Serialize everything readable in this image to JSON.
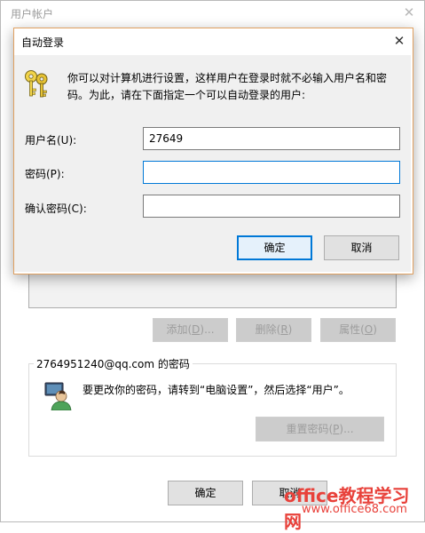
{
  "background_window": {
    "title": "用户帐户",
    "close_glyph": "✕",
    "buttons": {
      "add_prefix": "添加(",
      "add_key": "D",
      "add_suffix": ")...",
      "remove_prefix": "删除(",
      "remove_key": "R",
      "remove_suffix": ")",
      "props_prefix": "属性(",
      "props_key": "O",
      "props_suffix": ")"
    },
    "password_group": {
      "title": "2764951240@qq.com 的密码",
      "hint": "要更改你的密码，请转到“电脑设置”，然后选择“用户”。",
      "reset_prefix": "重置密码(",
      "reset_key": "P",
      "reset_suffix": ")..."
    },
    "footer": {
      "ok_label": "确定",
      "cancel_label": "取消"
    }
  },
  "dialog": {
    "title": "自动登录",
    "close_glyph": "✕",
    "description": "你可以对计算机进行设置，这样用户在登录时就不必输入用户名和密码。为此，请在下面指定一个可以自动登录的用户:",
    "fields": {
      "username_label": "用户名(U):",
      "username_value": "27649",
      "password_label": "密码(P):",
      "password_value": "",
      "confirm_label": "确认密码(C):",
      "confirm_value": ""
    },
    "ok_label": "确定",
    "cancel_label": "取消"
  },
  "watermark": {
    "line1": "office教程学习网",
    "line2": "www.office68.com"
  },
  "icons": {
    "dialog_icon": "keys-icon",
    "user_icon": "user-icon"
  },
  "colors": {
    "accent": "#0078d7",
    "dialog_border": "#e0a060",
    "watermark": "#e8413a"
  }
}
